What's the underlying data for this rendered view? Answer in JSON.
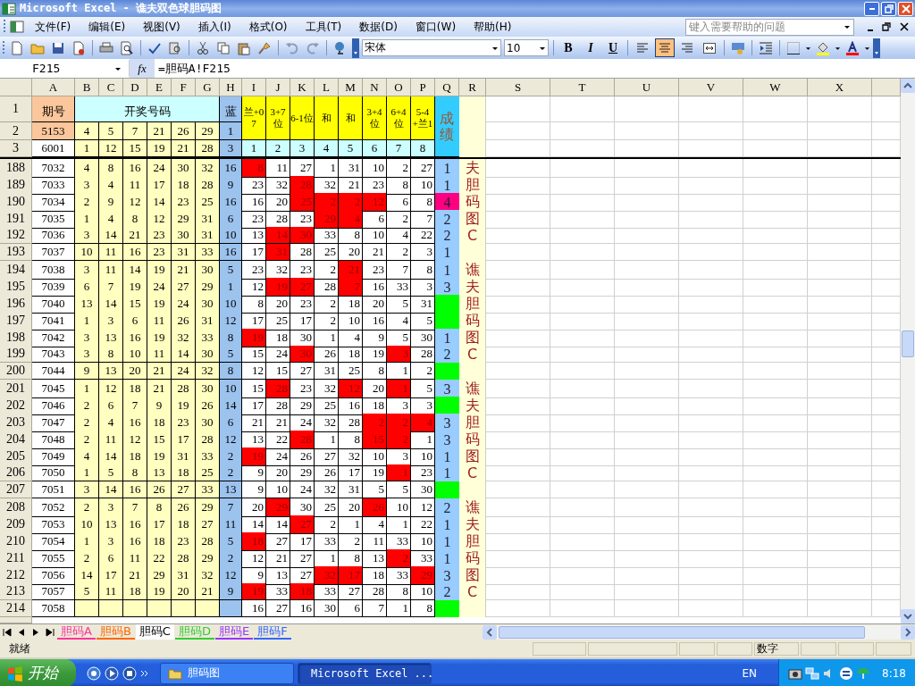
{
  "window": {
    "title": "Microsoft Excel - 谯夫双色球胆码图"
  },
  "menu": [
    "文件(F)",
    "编辑(E)",
    "视图(V)",
    "插入(I)",
    "格式(O)",
    "工具(T)",
    "数据(D)",
    "窗口(W)",
    "帮助(H)"
  ],
  "help_box": {
    "placeholder": "键入需要帮助的问题"
  },
  "toolbar": {
    "font": "宋体",
    "size": "10",
    "bold": "B",
    "italic": "I",
    "underline": "U",
    "alignment": [
      {
        "selected": false
      },
      {
        "selected": true
      },
      {
        "selected": false
      },
      {
        "selected": false
      }
    ]
  },
  "formula_bar": {
    "name_box": "F215",
    "fx": "fx",
    "formula": "=胆码A!F215"
  },
  "columns": [
    "A",
    "B",
    "C",
    "D",
    "E",
    "F",
    "G",
    "H",
    "I",
    "J",
    "K",
    "L",
    "M",
    "N",
    "O",
    "P",
    "Q",
    "R",
    "S",
    "T",
    "U",
    "V",
    "W",
    "X"
  ],
  "header": {
    "row_numbers": [
      "1",
      "2",
      "3"
    ],
    "period_label": "期号",
    "draw_label": "开奖号码",
    "blue_label": "蓝",
    "score_label": "成绩",
    "cols": [
      "兰+07",
      "3+7位",
      "6-1位",
      "和",
      "和",
      "3+4位",
      "6+4位",
      "5-4+兰1"
    ],
    "row2": {
      "id": "5153",
      "balls": [
        "4",
        "5",
        "7",
        "21",
        "26",
        "29"
      ],
      "blue": "1"
    },
    "row3": {
      "id": "6001",
      "balls": [
        "1",
        "12",
        "15",
        "19",
        "21",
        "28"
      ],
      "blue": "3",
      "indexes": [
        "1",
        "2",
        "3",
        "4",
        "5",
        "6",
        "7",
        "8"
      ]
    }
  },
  "rows": [
    {
      "n": "188",
      "id": "7032",
      "balls": [
        "4",
        "8",
        "16",
        "24",
        "30",
        "32"
      ],
      "blue": "16",
      "v": [
        "8",
        "11",
        "27",
        "1",
        "31",
        "10",
        "2",
        "27"
      ],
      "hit": [
        true,
        false,
        false,
        false,
        false,
        false,
        false,
        false
      ],
      "score": "1",
      "color": "#99ccff",
      "r": "夫"
    },
    {
      "n": "189",
      "id": "7033",
      "balls": [
        "3",
        "4",
        "11",
        "17",
        "18",
        "28"
      ],
      "blue": "9",
      "v": [
        "23",
        "32",
        "28",
        "32",
        "21",
        "23",
        "8",
        "10"
      ],
      "hit": [
        false,
        false,
        true,
        false,
        false,
        false,
        false,
        false
      ],
      "score": "1",
      "color": "#99ccff",
      "r": "胆"
    },
    {
      "n": "190",
      "id": "7034",
      "balls": [
        "2",
        "9",
        "12",
        "14",
        "23",
        "25"
      ],
      "blue": "16",
      "v": [
        "16",
        "20",
        "25",
        "2",
        "2",
        "12",
        "6",
        "8"
      ],
      "hit": [
        false,
        false,
        true,
        true,
        true,
        true,
        false,
        false
      ],
      "score": "4",
      "color": "#ff0080",
      "r": "码"
    },
    {
      "n": "191",
      "id": "7035",
      "balls": [
        "1",
        "4",
        "8",
        "12",
        "29",
        "31"
      ],
      "blue": "6",
      "v": [
        "23",
        "28",
        "23",
        "29",
        "4",
        "6",
        "2",
        "7"
      ],
      "hit": [
        false,
        false,
        false,
        true,
        true,
        false,
        false,
        false
      ],
      "score": "2",
      "color": "#99ccff",
      "r": "图"
    },
    {
      "n": "192",
      "id": "7036",
      "balls": [
        "3",
        "14",
        "21",
        "23",
        "30",
        "31"
      ],
      "blue": "10",
      "v": [
        "13",
        "14",
        "30",
        "33",
        "8",
        "10",
        "4",
        "22"
      ],
      "hit": [
        false,
        true,
        true,
        false,
        false,
        false,
        false,
        false
      ],
      "score": "2",
      "color": "#99ccff",
      "r": "C"
    },
    {
      "n": "193",
      "id": "7037",
      "balls": [
        "10",
        "11",
        "16",
        "23",
        "31",
        "33"
      ],
      "blue": "16",
      "v": [
        "17",
        "31",
        "28",
        "25",
        "20",
        "21",
        "2",
        "3"
      ],
      "hit": [
        false,
        true,
        false,
        false,
        false,
        false,
        false,
        false
      ],
      "score": "1",
      "color": "#99ccff"
    },
    {
      "n": "194",
      "id": "7038",
      "balls": [
        "3",
        "11",
        "14",
        "19",
        "21",
        "30"
      ],
      "blue": "5",
      "v": [
        "23",
        "32",
        "23",
        "2",
        "21",
        "23",
        "7",
        "8"
      ],
      "hit": [
        false,
        false,
        false,
        false,
        true,
        false,
        false,
        false
      ],
      "score": "1",
      "color": "#99ccff",
      "r": "谯"
    },
    {
      "n": "195",
      "id": "7039",
      "balls": [
        "6",
        "7",
        "19",
        "24",
        "27",
        "29"
      ],
      "blue": "1",
      "v": [
        "12",
        "19",
        "27",
        "28",
        "7",
        "16",
        "33",
        "3"
      ],
      "hit": [
        false,
        true,
        true,
        false,
        true,
        false,
        false,
        false
      ],
      "score": "3",
      "color": "#99ccff",
      "r": "夫"
    },
    {
      "n": "196",
      "id": "7040",
      "balls": [
        "13",
        "14",
        "15",
        "19",
        "24",
        "30"
      ],
      "blue": "10",
      "v": [
        "8",
        "20",
        "23",
        "2",
        "18",
        "20",
        "5",
        "31"
      ],
      "hit": [
        false,
        false,
        false,
        false,
        false,
        false,
        false,
        false
      ],
      "color": "#00ff00",
      "r": "胆"
    },
    {
      "n": "197",
      "id": "7041",
      "balls": [
        "1",
        "3",
        "6",
        "11",
        "26",
        "31"
      ],
      "blue": "12",
      "v": [
        "17",
        "25",
        "17",
        "2",
        "10",
        "16",
        "4",
        "5"
      ],
      "hit": [
        false,
        false,
        false,
        false,
        false,
        false,
        false,
        false
      ],
      "color": "#00ff00",
      "r": "码"
    },
    {
      "n": "198",
      "id": "7042",
      "balls": [
        "3",
        "13",
        "16",
        "19",
        "32",
        "33"
      ],
      "blue": "8",
      "v": [
        "19",
        "18",
        "30",
        "1",
        "4",
        "9",
        "5",
        "30"
      ],
      "hit": [
        true,
        false,
        false,
        false,
        false,
        false,
        false,
        false
      ],
      "score": "1",
      "color": "#99ccff",
      "r": "图"
    },
    {
      "n": "199",
      "id": "7043",
      "balls": [
        "3",
        "8",
        "10",
        "11",
        "14",
        "30"
      ],
      "blue": "5",
      "v": [
        "15",
        "24",
        "30",
        "26",
        "18",
        "19",
        "3",
        "28"
      ],
      "hit": [
        false,
        false,
        true,
        false,
        false,
        false,
        true,
        false
      ],
      "score": "2",
      "color": "#99ccff",
      "r": "C"
    },
    {
      "n": "200",
      "id": "7044",
      "balls": [
        "9",
        "13",
        "20",
        "21",
        "24",
        "32"
      ],
      "blue": "8",
      "v": [
        "12",
        "15",
        "27",
        "31",
        "25",
        "8",
        "1",
        "2"
      ],
      "hit": [
        false,
        false,
        false,
        false,
        false,
        false,
        false,
        false
      ],
      "color": "#00ff00"
    },
    {
      "n": "201",
      "id": "7045",
      "balls": [
        "1",
        "12",
        "18",
        "21",
        "28",
        "30"
      ],
      "blue": "10",
      "v": [
        "15",
        "28",
        "23",
        "32",
        "12",
        "20",
        "1",
        "5"
      ],
      "hit": [
        false,
        true,
        false,
        false,
        true,
        false,
        true,
        false
      ],
      "score": "3",
      "color": "#99ccff",
      "r": "谯"
    },
    {
      "n": "202",
      "id": "7046",
      "balls": [
        "2",
        "6",
        "7",
        "9",
        "19",
        "26"
      ],
      "blue": "14",
      "v": [
        "17",
        "28",
        "29",
        "25",
        "16",
        "18",
        "3",
        "3"
      ],
      "hit": [
        false,
        false,
        false,
        false,
        false,
        false,
        false,
        false
      ],
      "color": "#00ff00",
      "r": "夫"
    },
    {
      "n": "203",
      "id": "7047",
      "balls": [
        "2",
        "4",
        "16",
        "18",
        "23",
        "30"
      ],
      "blue": "6",
      "v": [
        "21",
        "21",
        "24",
        "32",
        "28",
        "2",
        "2",
        "4"
      ],
      "hit": [
        false,
        false,
        false,
        false,
        false,
        true,
        true,
        true
      ],
      "score": "3",
      "color": "#99ccff",
      "r": "胆"
    },
    {
      "n": "204",
      "id": "7048",
      "balls": [
        "2",
        "11",
        "12",
        "15",
        "17",
        "28"
      ],
      "blue": "12",
      "v": [
        "13",
        "22",
        "28",
        "1",
        "8",
        "15",
        "2",
        "1"
      ],
      "hit": [
        false,
        false,
        true,
        false,
        false,
        true,
        true,
        false
      ],
      "score": "3",
      "color": "#99ccff",
      "r": "码"
    },
    {
      "n": "205",
      "id": "7049",
      "balls": [
        "4",
        "14",
        "18",
        "19",
        "31",
        "33"
      ],
      "blue": "2",
      "v": [
        "19",
        "24",
        "26",
        "27",
        "32",
        "10",
        "3",
        "10"
      ],
      "hit": [
        true,
        false,
        false,
        false,
        false,
        false,
        false,
        false
      ],
      "score": "1",
      "color": "#99ccff",
      "r": "图"
    },
    {
      "n": "206",
      "id": "7050",
      "balls": [
        "1",
        "5",
        "8",
        "13",
        "18",
        "25"
      ],
      "blue": "2",
      "v": [
        "9",
        "20",
        "29",
        "26",
        "17",
        "19",
        "1",
        "23"
      ],
      "hit": [
        false,
        false,
        false,
        false,
        false,
        false,
        true,
        false
      ],
      "score": "1",
      "color": "#99ccff",
      "r": "C"
    },
    {
      "n": "207",
      "id": "7051",
      "balls": [
        "3",
        "14",
        "16",
        "26",
        "27",
        "33"
      ],
      "blue": "13",
      "v": [
        "9",
        "10",
        "24",
        "32",
        "31",
        "5",
        "5",
        "30"
      ],
      "hit": [
        false,
        false,
        false,
        false,
        false,
        false,
        false,
        false
      ],
      "color": "#00ff00"
    },
    {
      "n": "208",
      "id": "7052",
      "balls": [
        "2",
        "3",
        "7",
        "8",
        "26",
        "29"
      ],
      "blue": "7",
      "v": [
        "20",
        "29",
        "30",
        "25",
        "20",
        "26",
        "10",
        "12"
      ],
      "hit": [
        false,
        true,
        false,
        false,
        false,
        true,
        false,
        false
      ],
      "score": "2",
      "color": "#99ccff",
      "r": "谯"
    },
    {
      "n": "209",
      "id": "7053",
      "balls": [
        "10",
        "13",
        "16",
        "17",
        "18",
        "27"
      ],
      "blue": "11",
      "v": [
        "14",
        "14",
        "27",
        "2",
        "1",
        "4",
        "1",
        "22"
      ],
      "hit": [
        false,
        false,
        true,
        false,
        false,
        false,
        false,
        false
      ],
      "score": "1",
      "color": "#99ccff",
      "r": "夫"
    },
    {
      "n": "210",
      "id": "7054",
      "balls": [
        "1",
        "3",
        "16",
        "18",
        "23",
        "28"
      ],
      "blue": "5",
      "v": [
        "18",
        "27",
        "17",
        "33",
        "2",
        "11",
        "33",
        "10"
      ],
      "hit": [
        true,
        false,
        false,
        false,
        false,
        false,
        false,
        false
      ],
      "score": "1",
      "color": "#99ccff",
      "r": "胆"
    },
    {
      "n": "211",
      "id": "7055",
      "balls": [
        "2",
        "6",
        "11",
        "22",
        "28",
        "29"
      ],
      "blue": "2",
      "v": [
        "12",
        "21",
        "27",
        "1",
        "8",
        "13",
        "2",
        "33"
      ],
      "hit": [
        false,
        false,
        false,
        false,
        false,
        false,
        true,
        false
      ],
      "score": "1",
      "color": "#99ccff",
      "r": "码"
    },
    {
      "n": "212",
      "id": "7056",
      "balls": [
        "14",
        "17",
        "21",
        "29",
        "31",
        "32"
      ],
      "blue": "12",
      "v": [
        "9",
        "13",
        "27",
        "32",
        "17",
        "18",
        "33",
        "29"
      ],
      "hit": [
        false,
        false,
        false,
        true,
        true,
        false,
        false,
        true
      ],
      "score": "3",
      "color": "#99ccff",
      "r": "图"
    },
    {
      "n": "213",
      "id": "7057",
      "balls": [
        "5",
        "11",
        "18",
        "19",
        "20",
        "21"
      ],
      "blue": "9",
      "v": [
        "19",
        "33",
        "18",
        "33",
        "27",
        "28",
        "8",
        "10"
      ],
      "hit": [
        true,
        false,
        true,
        false,
        false,
        false,
        false,
        false
      ],
      "score": "2",
      "color": "#99ccff",
      "r": "C"
    },
    {
      "n": "214",
      "id": "7058",
      "v": [
        "16",
        "27",
        "16",
        "30",
        "6",
        "7",
        "1",
        "8"
      ],
      "hit": [
        false,
        false,
        false,
        false,
        false,
        false,
        false,
        false
      ],
      "color": "#00ff00"
    }
  ],
  "sheet_tabs": [
    {
      "label": "胆码A",
      "selected": false,
      "color": "#ff3399"
    },
    {
      "label": "胆码B",
      "selected": false,
      "color": "#ff6600"
    },
    {
      "label": "胆码C",
      "selected": true,
      "color": "#000000"
    },
    {
      "label": "胆码D",
      "selected": false,
      "color": "#33cc33"
    },
    {
      "label": "胆码E",
      "selected": false,
      "color": "#9933ff"
    },
    {
      "label": "胆码F",
      "selected": false,
      "color": "#3366ff"
    }
  ],
  "status": {
    "ready": "就绪",
    "mode": "数字"
  },
  "taskbar": {
    "start": "开始",
    "items": [
      {
        "label": "胆码图",
        "kind": "folder",
        "selected": false
      },
      {
        "label": "Microsoft Excel ...",
        "kind": "excel",
        "selected": true
      }
    ],
    "lang": "EN",
    "clock": "8:18"
  }
}
